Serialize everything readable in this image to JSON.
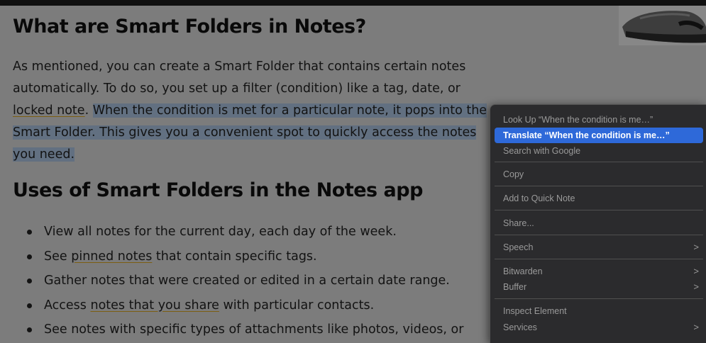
{
  "article": {
    "heading1": "What are Smart Folders in Notes?",
    "para_line1": "As mentioned, you can create a Smart Folder that contains certain notes",
    "para_line2": "automatically. To do so, you set up a filter (condition) like a tag, date, or",
    "para_line3_link": "locked note",
    "para_line3_dot": ".",
    "para_line3_hl": "When the condition is met for a particular note, it pops into the",
    "para_line4_hl": "Smart Folder. This gives you a convenient spot to quickly access the notes",
    "para_line5_hl": "you need.",
    "heading2": "Uses of Smart Folders in the Notes app",
    "bullets": [
      {
        "text": "View all notes for the current day, each day of the week."
      },
      {
        "pre": "See ",
        "link": "pinned notes",
        "post": " that contain specific tags."
      },
      {
        "text": "Gather notes that were created or edited in a certain date range."
      },
      {
        "pre": "Access ",
        "link": "notes that you share",
        "post": " with particular contacts."
      },
      {
        "text": "See notes with specific types of attachments like photos, videos, or"
      }
    ]
  },
  "context_menu": {
    "items": [
      {
        "label": "Look Up “When the condition is me…”"
      },
      {
        "label": "Translate “When the condition is me…”",
        "selected": true
      },
      {
        "label": "Search with Google"
      },
      {
        "label": "Copy"
      },
      {
        "label": "Add to Quick Note"
      },
      {
        "label": "Share..."
      },
      {
        "label": "Speech",
        "submenu": true
      },
      {
        "label": "Bitwarden",
        "submenu": true
      },
      {
        "label": "Buffer",
        "submenu": true
      },
      {
        "label": "Inspect Element"
      },
      {
        "label": "Services",
        "submenu": true
      }
    ],
    "submenu_arrow": ">"
  },
  "colors": {
    "selection_highlight": "#a9c2de",
    "menu_selected": "#2e69d9",
    "link_underline": "#d6a21e"
  }
}
